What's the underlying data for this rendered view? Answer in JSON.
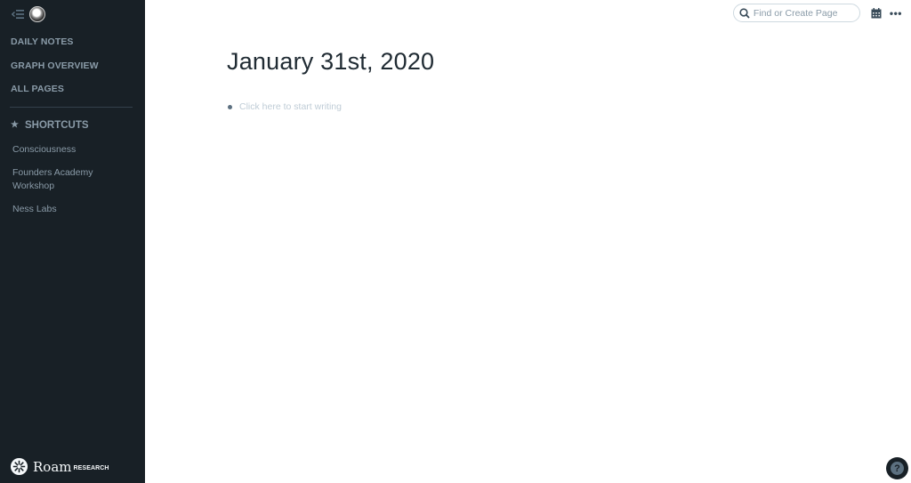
{
  "sidebar": {
    "nav": [
      {
        "label": "DAILY NOTES"
      },
      {
        "label": "GRAPH OVERVIEW"
      },
      {
        "label": "ALL PAGES"
      }
    ],
    "shortcuts_heading": "SHORTCUTS",
    "star_glyph": "★",
    "shortcuts": [
      {
        "label": "Consciousness"
      },
      {
        "label": "Founders Academy Workshop"
      },
      {
        "label": "Ness Labs"
      }
    ],
    "logo": {
      "name": "Roam",
      "sub": "RESEARCH"
    }
  },
  "topbar": {
    "search_placeholder": "Find or Create Page",
    "more_glyph": "•••"
  },
  "page": {
    "title": "January 31st, 2020",
    "block_placeholder": "Click here to start writing"
  },
  "help": {
    "glyph": "?"
  }
}
